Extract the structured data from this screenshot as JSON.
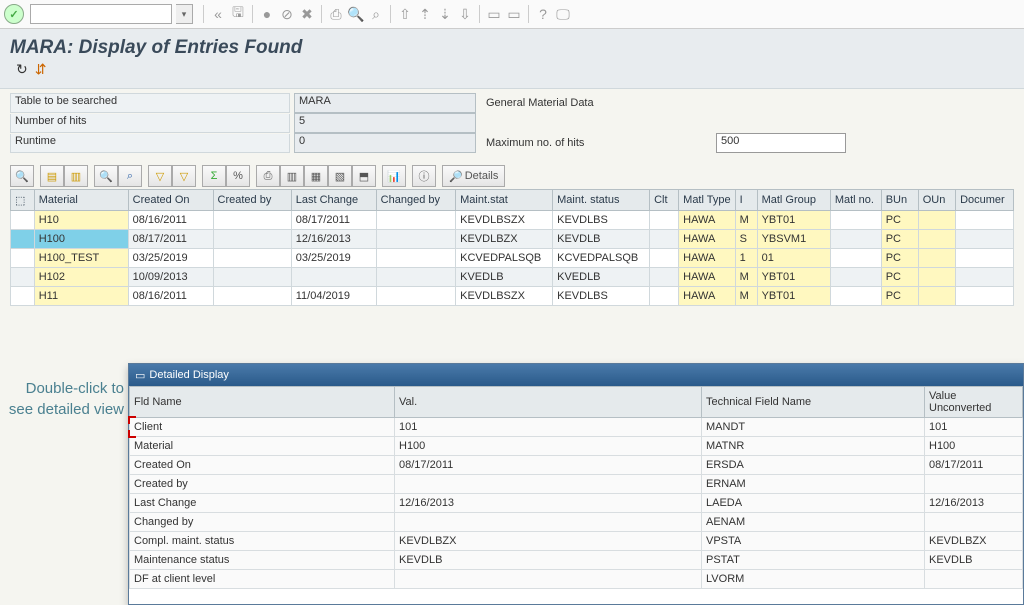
{
  "title": "MARA: Display of Entries Found",
  "annotation": "Double-click to see detailed view",
  "params": {
    "table_label": "Table to be searched",
    "table_value": "MARA",
    "table_desc": "General Material Data",
    "hits_label": "Number of hits",
    "hits_value": "5",
    "runtime_label": "Runtime",
    "runtime_value": "0",
    "maxhits_label": "Maximum no. of hits",
    "maxhits_value": "500"
  },
  "grid": {
    "headers": [
      "",
      "Material",
      "Created On",
      "Created by",
      "Last Change",
      "Changed by",
      "Maint.stat",
      "Maint. status",
      "Clt",
      "Matl Type",
      "I",
      "Matl Group",
      "Matl no.",
      "BUn",
      "OUn",
      "Documer"
    ],
    "rows": [
      {
        "sel": false,
        "material": "H10",
        "created_on": "08/16/2011",
        "created_by": "",
        "last_change": "08/17/2011",
        "changed_by": "",
        "maint_stat": "KEVDLBSZX",
        "maint_status": "KEVDLBS",
        "clt": "",
        "matl_type": "HAWA",
        "i": "M",
        "matl_group": "YBT01",
        "matl_no": "",
        "bun": "PC",
        "oun": "",
        "doc": ""
      },
      {
        "sel": true,
        "material": "H100",
        "created_on": "08/17/2011",
        "created_by": "",
        "last_change": "12/16/2013",
        "changed_by": "",
        "maint_stat": "KEVDLBZX",
        "maint_status": "KEVDLB",
        "clt": "",
        "matl_type": "HAWA",
        "i": "S",
        "matl_group": "YBSVM1",
        "matl_no": "",
        "bun": "PC",
        "oun": "",
        "doc": ""
      },
      {
        "sel": false,
        "material": "H100_TEST",
        "created_on": "03/25/2019",
        "created_by": "",
        "last_change": "03/25/2019",
        "changed_by": "",
        "maint_stat": "KCVEDPALSQB",
        "maint_status": "KCVEDPALSQB",
        "clt": "",
        "matl_type": "HAWA",
        "i": "1",
        "matl_group": "01",
        "matl_no": "",
        "bun": "PC",
        "oun": "",
        "doc": ""
      },
      {
        "sel": false,
        "material": "H102",
        "created_on": "10/09/2013",
        "created_by": "",
        "last_change": "",
        "changed_by": "",
        "maint_stat": "KVEDLB",
        "maint_status": "KVEDLB",
        "clt": "",
        "matl_type": "HAWA",
        "i": "M",
        "matl_group": "YBT01",
        "matl_no": "",
        "bun": "PC",
        "oun": "",
        "doc": ""
      },
      {
        "sel": false,
        "material": "H11",
        "created_on": "08/16/2011",
        "created_by": "",
        "last_change": "11/04/2019",
        "changed_by": "",
        "maint_stat": "KEVDLBSZX",
        "maint_status": "KEVDLBS",
        "clt": "",
        "matl_type": "HAWA",
        "i": "M",
        "matl_group": "YBT01",
        "matl_no": "",
        "bun": "PC",
        "oun": "",
        "doc": ""
      }
    ]
  },
  "alv": {
    "details_label": "Details"
  },
  "detail": {
    "title": "Detailed Display",
    "headers": [
      "Fld Name",
      "Val.",
      "Technical Field Name",
      "Value Unconverted"
    ],
    "rows": [
      {
        "fld": "Client",
        "val": "101",
        "tech": "MANDT",
        "unconv": "101"
      },
      {
        "fld": "Material",
        "val": "H100",
        "tech": "MATNR",
        "unconv": "H100"
      },
      {
        "fld": "Created On",
        "val": "08/17/2011",
        "tech": "ERSDA",
        "unconv": "08/17/2011"
      },
      {
        "fld": "Created by",
        "val": "",
        "tech": "ERNAM",
        "unconv": ""
      },
      {
        "fld": "Last Change",
        "val": "12/16/2013",
        "tech": "LAEDA",
        "unconv": "12/16/2013"
      },
      {
        "fld": "Changed by",
        "val": "",
        "tech": "AENAM",
        "unconv": ""
      },
      {
        "fld": "Compl. maint. status",
        "val": "KEVDLBZX",
        "tech": "VPSTA",
        "unconv": "KEVDLBZX"
      },
      {
        "fld": "Maintenance status",
        "val": "KEVDLB",
        "tech": "PSTAT",
        "unconv": "KEVDLB"
      },
      {
        "fld": "DF at client level",
        "val": "",
        "tech": "LVORM",
        "unconv": ""
      }
    ]
  }
}
